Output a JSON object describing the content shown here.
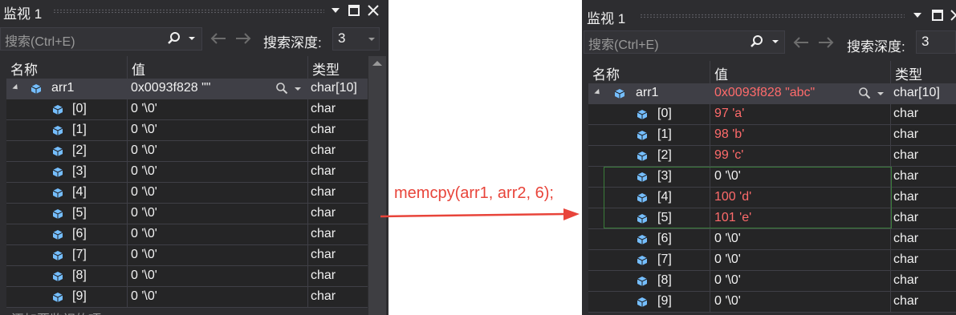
{
  "annotation": {
    "text": "memcpy(arr1, arr2, 6);",
    "color": "#e8443a"
  },
  "colors": {
    "changed_value": "#ff6b6b",
    "selected_row": "#3f3f46",
    "highlight_border": "#3a7d3a"
  },
  "before": {
    "title": "监视 1",
    "search_placeholder": "搜索(Ctrl+E)",
    "depth_label": "搜索深度:",
    "depth_value": "3",
    "columns": {
      "name": "名称",
      "value": "值",
      "type": "类型"
    },
    "parent": {
      "name": "arr1",
      "value": "0x0093f828 \"\"",
      "type": "char[10]"
    },
    "elements": [
      {
        "name": "[0]",
        "value": "0 '\\0'",
        "type": "char"
      },
      {
        "name": "[1]",
        "value": "0 '\\0'",
        "type": "char"
      },
      {
        "name": "[2]",
        "value": "0 '\\0'",
        "type": "char"
      },
      {
        "name": "[3]",
        "value": "0 '\\0'",
        "type": "char"
      },
      {
        "name": "[4]",
        "value": "0 '\\0'",
        "type": "char"
      },
      {
        "name": "[5]",
        "value": "0 '\\0'",
        "type": "char"
      },
      {
        "name": "[6]",
        "value": "0 '\\0'",
        "type": "char"
      },
      {
        "name": "[7]",
        "value": "0 '\\0'",
        "type": "char"
      },
      {
        "name": "[8]",
        "value": "0 '\\0'",
        "type": "char"
      },
      {
        "name": "[9]",
        "value": "0 '\\0'",
        "type": "char"
      }
    ],
    "add_hint": "添加要监视的项"
  },
  "after": {
    "title": "监视 1",
    "search_placeholder": "搜索(Ctrl+E)",
    "depth_label": "搜索深度:",
    "depth_value": "3",
    "columns": {
      "name": "名称",
      "value": "值",
      "type": "类型"
    },
    "parent": {
      "name": "arr1",
      "value": "0x0093f828 \"abc\"",
      "type": "char[10]"
    },
    "elements": [
      {
        "name": "[0]",
        "value": "97 'a'",
        "type": "char",
        "changed": true
      },
      {
        "name": "[1]",
        "value": "98 'b'",
        "type": "char",
        "changed": true
      },
      {
        "name": "[2]",
        "value": "99 'c'",
        "type": "char",
        "changed": true
      },
      {
        "name": "[3]",
        "value": "0 '\\0'",
        "type": "char",
        "changed": false
      },
      {
        "name": "[4]",
        "value": "100 'd'",
        "type": "char",
        "changed": true
      },
      {
        "name": "[5]",
        "value": "101 'e'",
        "type": "char",
        "changed": true
      },
      {
        "name": "[6]",
        "value": "0 '\\0'",
        "type": "char",
        "changed": false
      },
      {
        "name": "[7]",
        "value": "0 '\\0'",
        "type": "char",
        "changed": false
      },
      {
        "name": "[8]",
        "value": "0 '\\0'",
        "type": "char",
        "changed": false
      },
      {
        "name": "[9]",
        "value": "0 '\\0'",
        "type": "char",
        "changed": false
      }
    ]
  }
}
